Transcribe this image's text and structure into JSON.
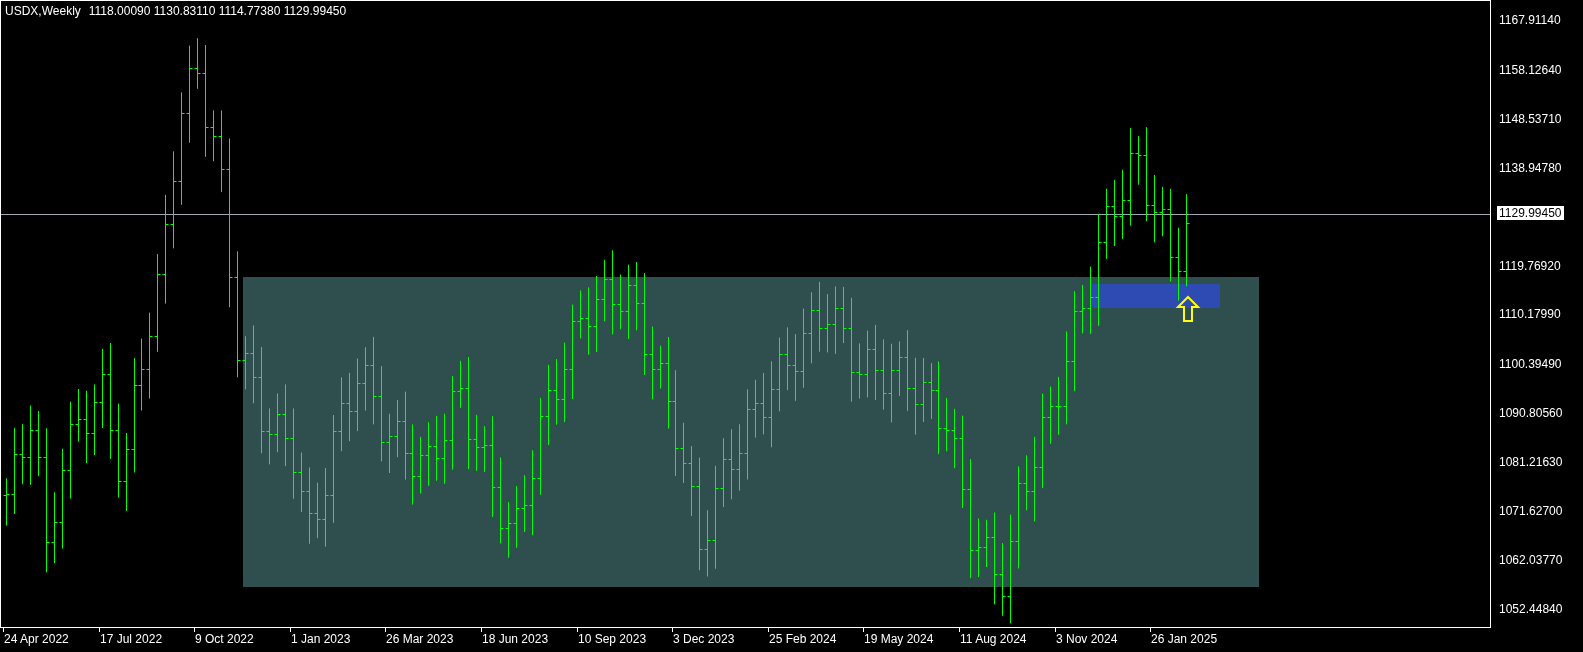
{
  "header": {
    "symbol": "USDX,Weekly",
    "prices": [
      "1118.00090",
      "1130.83110",
      "1114.77380",
      "1129.99450"
    ]
  },
  "chart": {
    "y_axis_labels": [
      "1167.91140",
      "1158.12640",
      "1148.53710",
      "1138.94780",
      "1119.76920",
      "1110.17990",
      "1100.39490",
      "1090.80560",
      "1081.21630",
      "1071.62700",
      "1062.03770",
      "1052.44840"
    ],
    "current_price": "1129.99450",
    "x_axis_labels": [
      "24 Apr 2022",
      "17 Jul 2022",
      "9 Oct 2022",
      "1 Jan 2023",
      "26 Mar 2023",
      "18 Jun 2023",
      "10 Sep 2023",
      "3 Dec 2023",
      "25 Feb 2024",
      "19 May 2024",
      "11 Aug 2024",
      "3 Nov 2024",
      "26 Jan 2025"
    ],
    "annotations": [
      {
        "kind": "zone",
        "color": "#2f4f4f"
      },
      {
        "kind": "highlight",
        "color": "#2e4bb3"
      },
      {
        "kind": "arrow",
        "color": "#ffff00"
      }
    ]
  }
}
